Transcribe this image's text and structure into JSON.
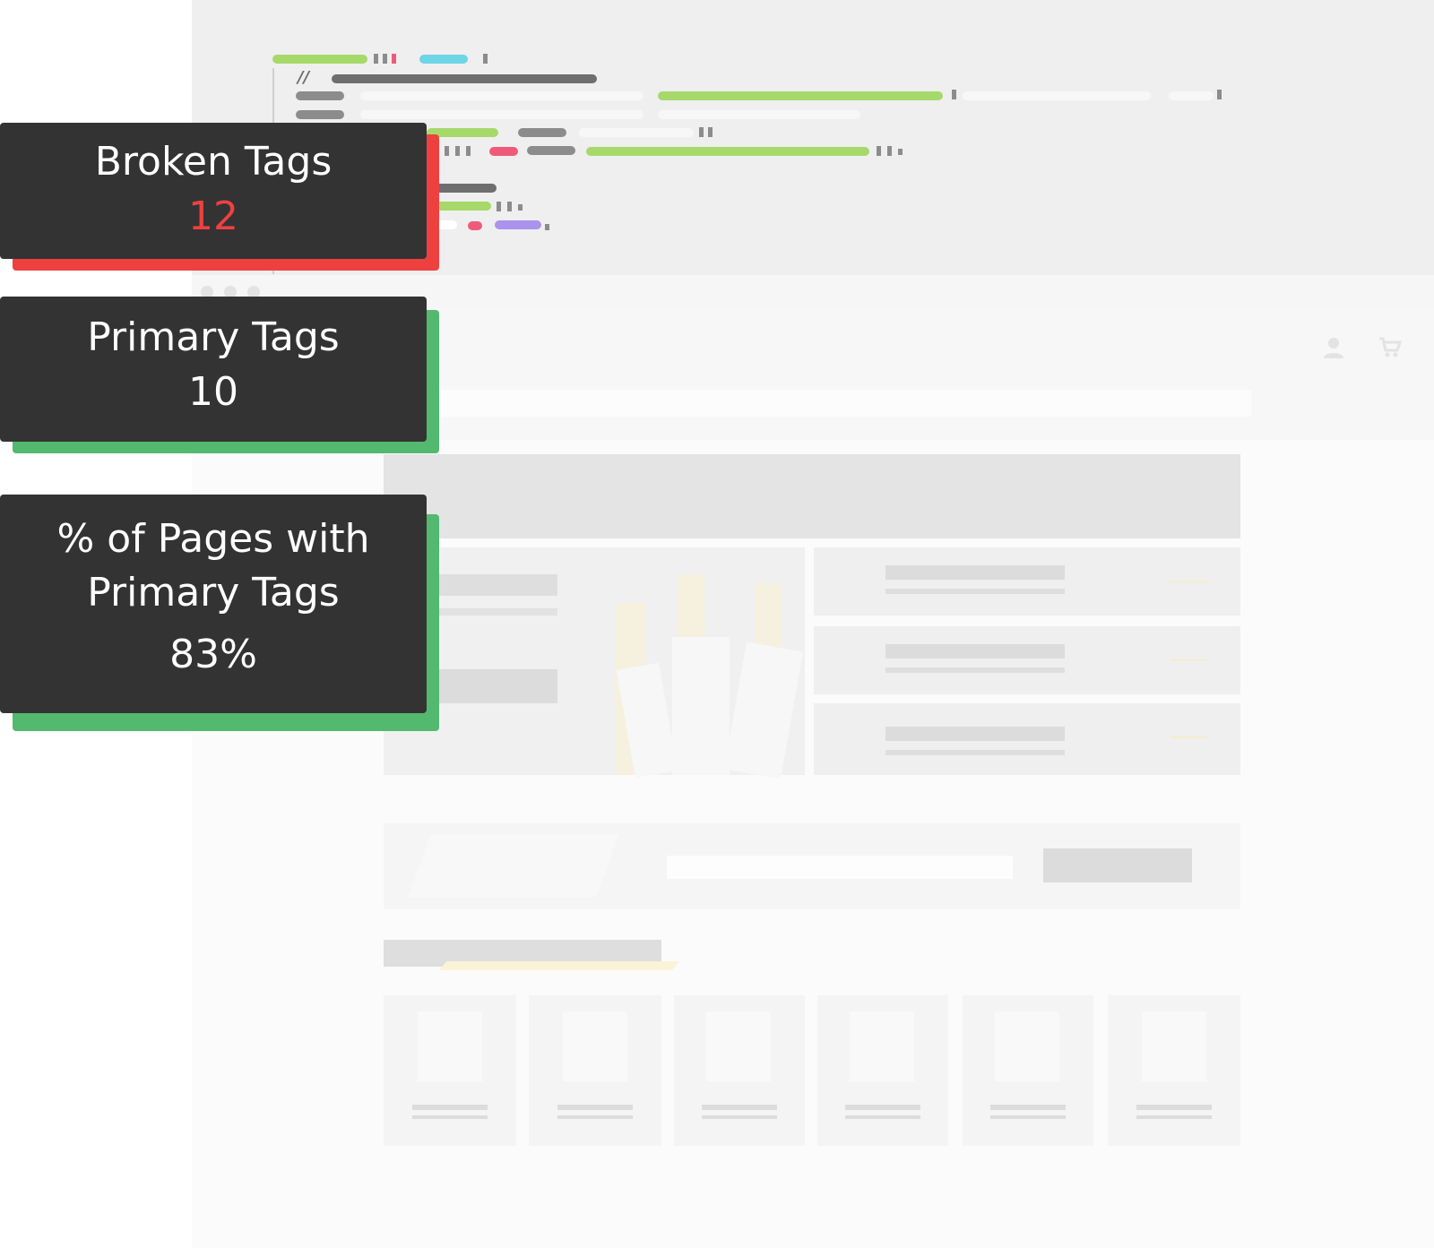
{
  "stats": [
    {
      "label": "Broken Tags",
      "value": "12",
      "value_color": "#ef4040",
      "accent": "#ef4040"
    },
    {
      "label": "Primary Tags",
      "value": "10",
      "value_color": "#ffffff",
      "accent": "#52b96f"
    },
    {
      "label": "% of Pages with Primary Tags",
      "value": "83%",
      "value_color": "#ffffff",
      "accent": "#52b96f"
    }
  ],
  "colors": {
    "card_bg": "#333333",
    "code_green": "#a6d96a",
    "code_cyan": "#6dd5e6",
    "code_pink": "#f05a7a",
    "code_purple": "#a993ec",
    "code_gray": "#7a7a7a"
  },
  "header_icons": [
    "user-icon",
    "cart-icon"
  ]
}
